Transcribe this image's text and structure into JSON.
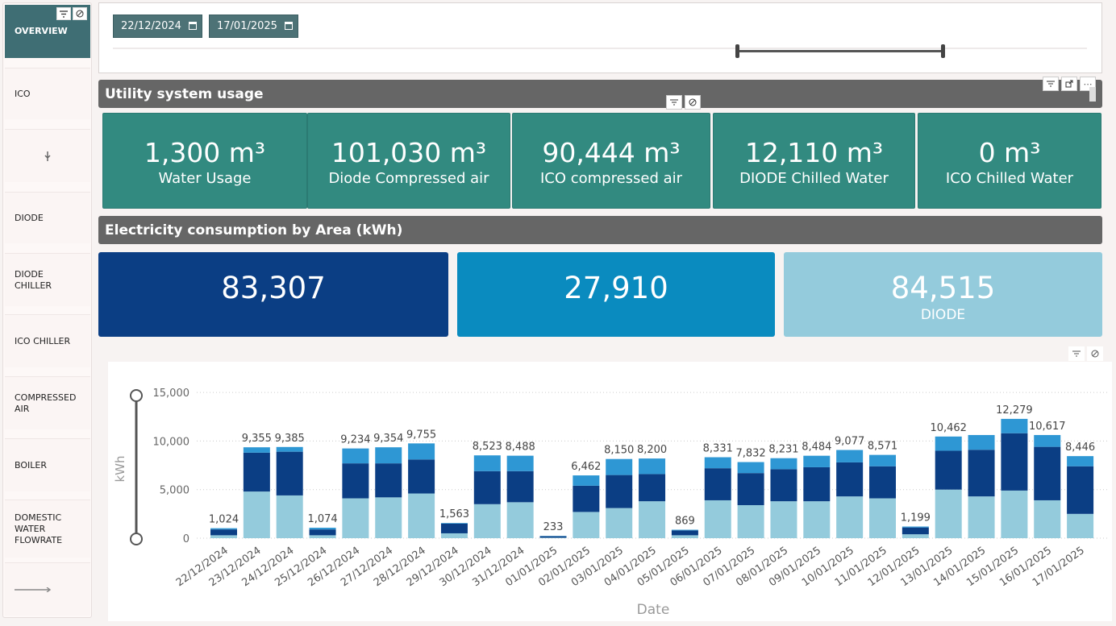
{
  "sidebar": {
    "items": [
      {
        "label": "OVERVIEW",
        "active": true
      },
      {
        "label": "ICO"
      },
      {
        "label": ""
      },
      {
        "label": "DIODE"
      },
      {
        "label": "DIODE CHILLER"
      },
      {
        "label": "ICO CHILLER"
      },
      {
        "label": "COMPRESSED AIR"
      },
      {
        "label": "BOILER"
      },
      {
        "label": "DOMESTIC WATER FLOWRATE"
      },
      {
        "label": ""
      }
    ]
  },
  "date_slicer": {
    "start": "22/12/2024",
    "end": "17/01/2025"
  },
  "utility": {
    "title": "Utility system usage",
    "cards": [
      {
        "value": "1,300 m³",
        "label": "Water Usage"
      },
      {
        "value": "101,030 m³",
        "label": "Diode Compressed air"
      },
      {
        "value": "90,444 m³",
        "label": "ICO compressed air"
      },
      {
        "value": "12,110 m³",
        "label": "DIODE Chilled Water"
      },
      {
        "value": "0 m³",
        "label": "ICO Chilled Water"
      }
    ]
  },
  "electricity": {
    "title": "Electricity consumption by Area (kWh)",
    "cards": [
      {
        "value": "83,307",
        "label": "",
        "color": "#0b3e84"
      },
      {
        "value": "27,910",
        "label": "",
        "color": "#0a8bbf"
      },
      {
        "value": "84,515",
        "label": "DIODE",
        "color": "#94cbdc"
      }
    ]
  },
  "colors": {
    "teal": "#328a80",
    "dark_blue": "#0b3e84",
    "mid_blue": "#2e97d4",
    "light_blue": "#94cbdc"
  },
  "chart_data": {
    "type": "bar",
    "stacked": true,
    "xlabel": "Date",
    "ylabel": "kWh",
    "ylim": [
      0,
      15000
    ],
    "yticks": [
      0,
      5000,
      10000,
      15000
    ],
    "ytick_labels": [
      "0",
      "5,000",
      "10,000",
      "15,000"
    ],
    "categories": [
      "22/12/2024",
      "23/12/2024",
      "24/12/2024",
      "25/12/2024",
      "26/12/2024",
      "27/12/2024",
      "28/12/2024",
      "29/12/2024",
      "30/12/2024",
      "31/12/2024",
      "01/01/2025",
      "02/01/2025",
      "03/01/2025",
      "04/01/2025",
      "05/01/2025",
      "06/01/2025",
      "07/01/2025",
      "08/01/2025",
      "09/01/2025",
      "10/01/2025",
      "11/01/2025",
      "12/01/2025",
      "13/01/2025",
      "14/01/2025",
      "15/01/2025",
      "16/01/2025",
      "17/01/2025"
    ],
    "totals": [
      1024,
      9355,
      9385,
      1074,
      9234,
      9354,
      9755,
      1563,
      8523,
      8488,
      233,
      6462,
      8150,
      8200,
      869,
      8331,
      7832,
      8231,
      8484,
      9077,
      8571,
      1199,
      10462,
      10617,
      12279,
      10617,
      8446
    ],
    "total_labels": [
      "1,024",
      "9,355",
      "9,385",
      "1,074",
      "9,234",
      "9,354",
      "9,755",
      "1,563",
      "8,523",
      "8,488",
      "233",
      "6,462",
      "8,150",
      "8,200",
      "869",
      "8,331",
      "7,832",
      "8,231",
      "8,484",
      "9,077",
      "8,571",
      "1,199",
      "10,462",
      "",
      "12,279",
      "10,617",
      "8,446"
    ],
    "series": [
      {
        "values": [
          300,
          4800,
          4400,
          300,
          4100,
          4200,
          4600,
          500,
          3500,
          3700,
          50,
          2700,
          3100,
          3800,
          300,
          3900,
          3400,
          3800,
          3800,
          4300,
          4100,
          400,
          5000,
          4300,
          4900,
          3900,
          2500
        ]
      },
      {
        "values": [
          600,
          4000,
          4500,
          600,
          3600,
          3500,
          3500,
          1000,
          3400,
          3200,
          150,
          2700,
          3400,
          2800,
          500,
          3300,
          3300,
          3300,
          3500,
          3500,
          3300,
          700,
          4000,
          4800,
          5900,
          5500,
          4900
        ]
      },
      {
        "values": [
          124,
          555,
          485,
          174,
          1534,
          1654,
          1655,
          63,
          1623,
          1588,
          33,
          1062,
          1650,
          1600,
          69,
          1131,
          1132,
          1131,
          1184,
          1277,
          1171,
          99,
          1462,
          1517,
          1479,
          1217,
          1046
        ]
      }
    ]
  }
}
